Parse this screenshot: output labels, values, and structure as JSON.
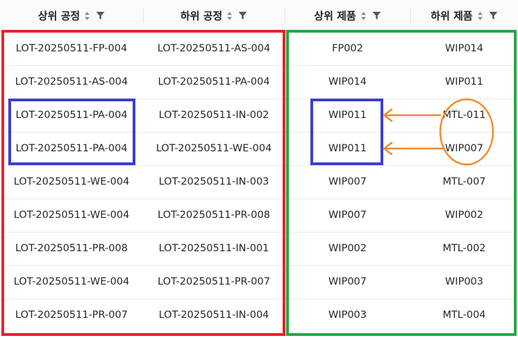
{
  "columns": [
    {
      "label": "상위 공정"
    },
    {
      "label": "하위 공정"
    },
    {
      "label": "상위 제품"
    },
    {
      "label": "하위 제품"
    }
  ],
  "rows": [
    [
      "LOT-20250511-FP-004",
      "LOT-20250511-AS-004",
      "FP002",
      "WIP014"
    ],
    [
      "LOT-20250511-AS-004",
      "LOT-20250511-PA-004",
      "WIP014",
      "WIP011"
    ],
    [
      "LOT-20250511-PA-004",
      "LOT-20250511-IN-002",
      "WIP011",
      "MTL-011"
    ],
    [
      "LOT-20250511-PA-004",
      "LOT-20250511-WE-004",
      "WIP011",
      "WIP007"
    ],
    [
      "LOT-20250511-WE-004",
      "LOT-20250511-IN-003",
      "WIP007",
      "MTL-007"
    ],
    [
      "LOT-20250511-WE-004",
      "LOT-20250511-PR-008",
      "WIP007",
      "WIP002"
    ],
    [
      "LOT-20250511-PR-008",
      "LOT-20250511-IN-001",
      "WIP002",
      "MTL-002"
    ],
    [
      "LOT-20250511-WE-004",
      "LOT-20250511-PR-007",
      "WIP007",
      "WIP003"
    ],
    [
      "LOT-20250511-PR-007",
      "LOT-20250511-IN-004",
      "WIP003",
      "MTL-004"
    ]
  ],
  "icons": {
    "sort": "sort-icon",
    "filter": "filter-icon"
  },
  "annotation_colors": {
    "upper_process_box": "#e8222d",
    "product_box": "#27a745",
    "highlight_box": "#3b3fd0",
    "arrow_and_circle": "#f08a2b"
  }
}
